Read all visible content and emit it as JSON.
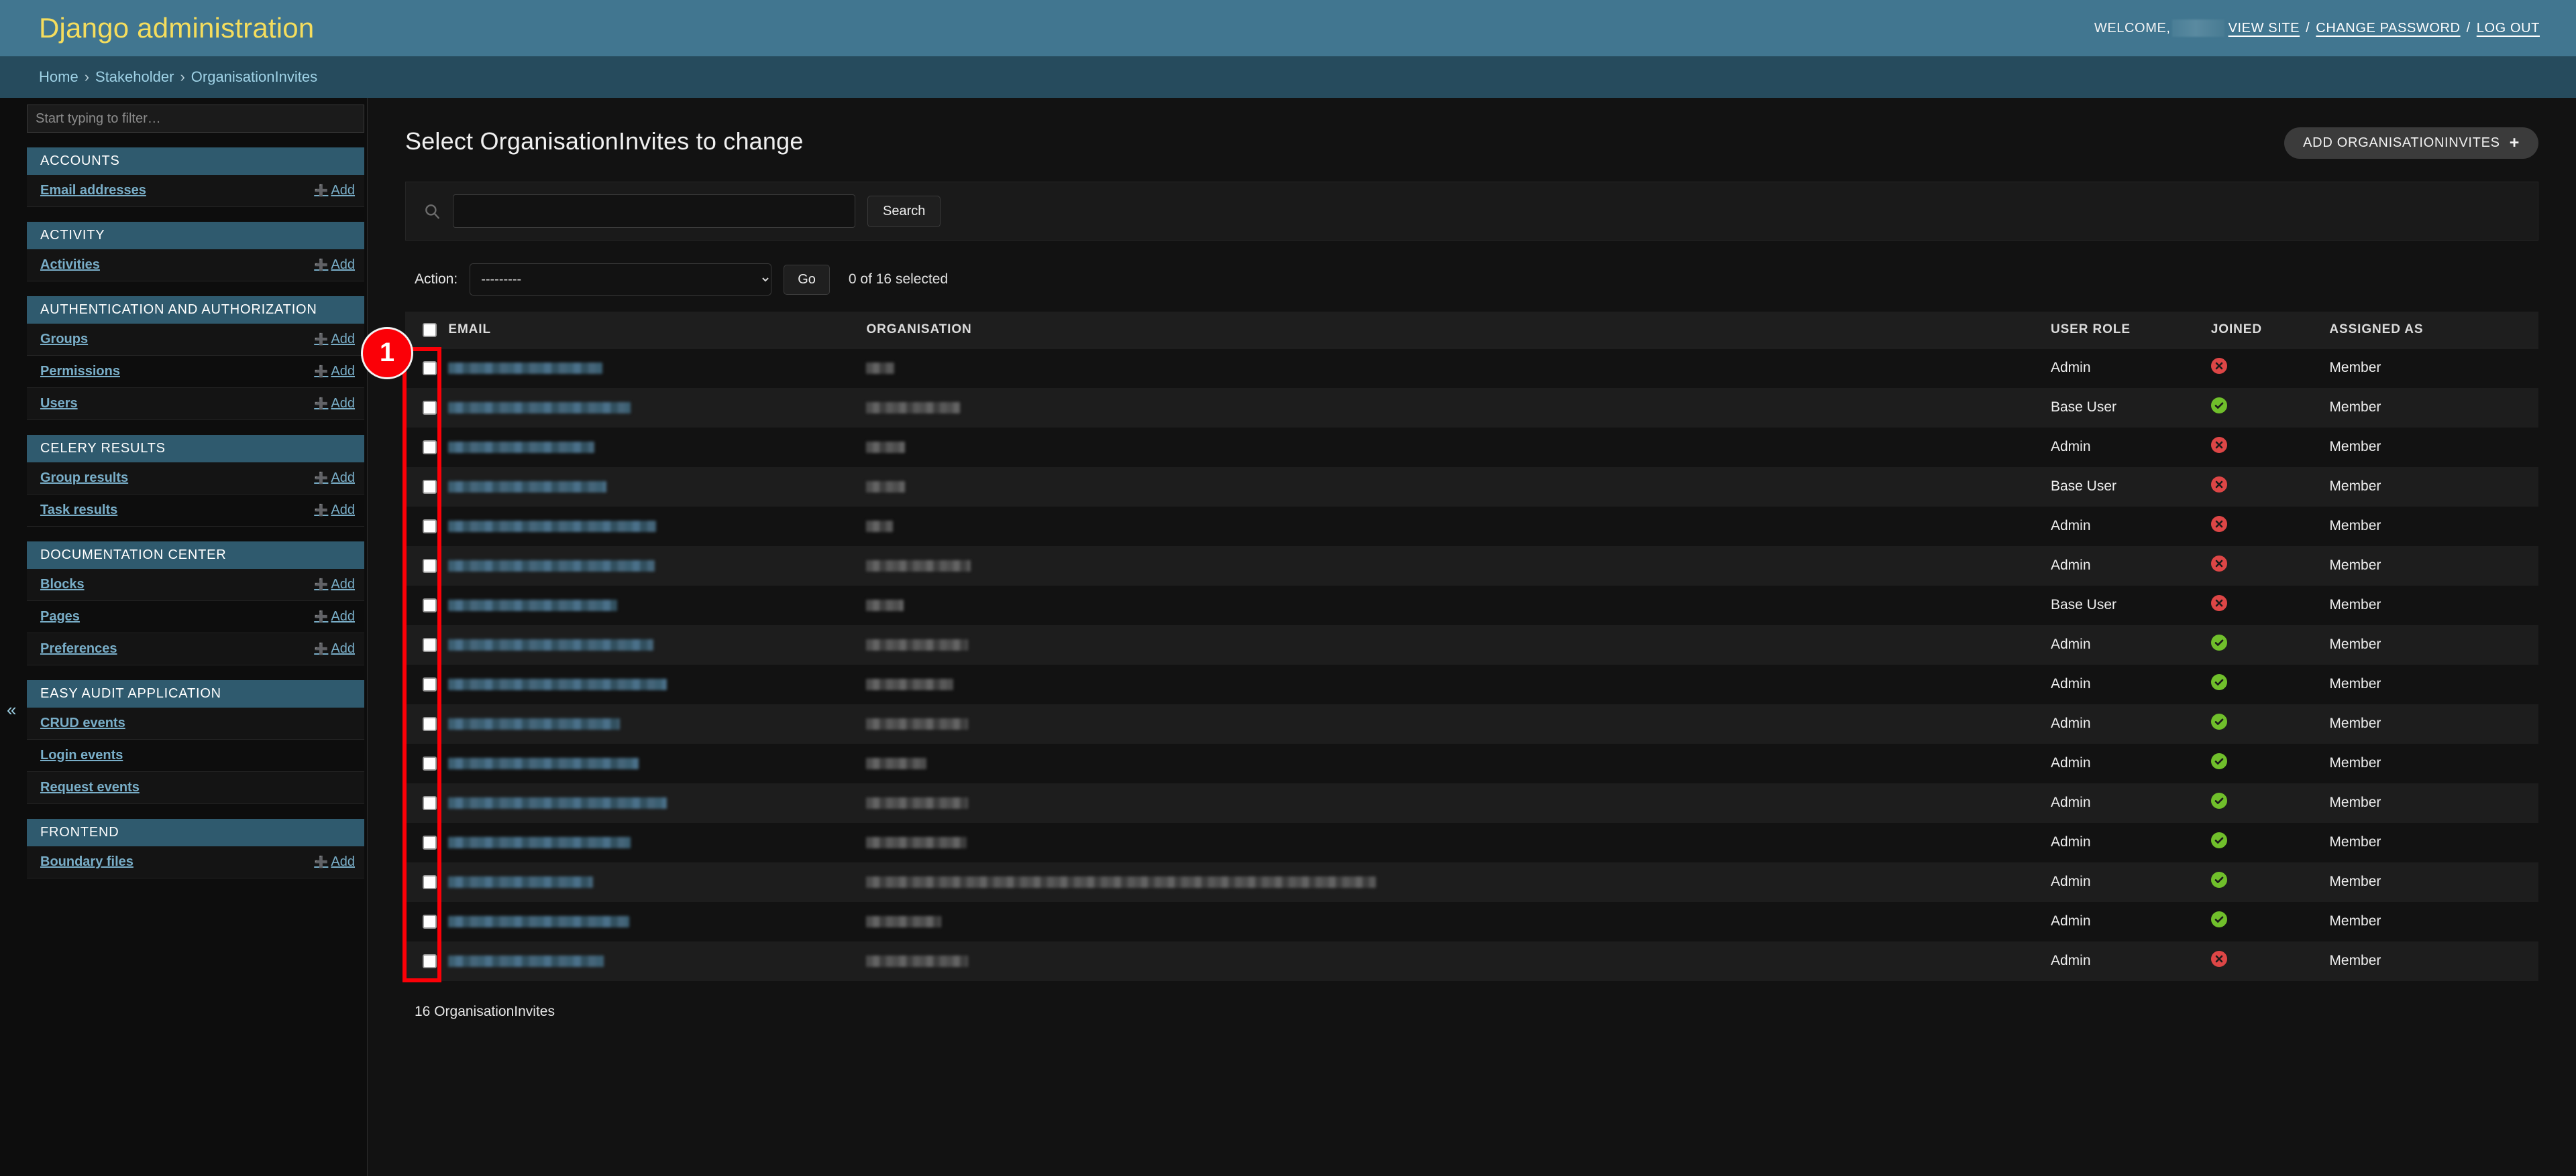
{
  "header": {
    "site_title": "Django administration",
    "welcome_label": "WELCOME,",
    "username_redacted": "",
    "links": [
      {
        "label": "VIEW SITE",
        "name": "view-site-link"
      },
      {
        "label": "CHANGE PASSWORD",
        "name": "change-password-link"
      },
      {
        "label": "LOG OUT",
        "name": "log-out-link"
      }
    ],
    "separator": "/"
  },
  "breadcrumbs": {
    "home": "Home",
    "app": "Stakeholder",
    "current": "OrganisationInvites",
    "separator": "›"
  },
  "sidebar": {
    "filter_placeholder": "Start typing to filter…",
    "filter_value": "",
    "collapse_icon": "«",
    "add_label": "Add",
    "apps": [
      {
        "caption": "ACCOUNTS",
        "models": [
          {
            "label": "Email addresses",
            "add": true
          }
        ]
      },
      {
        "caption": "ACTIVITY",
        "models": [
          {
            "label": "Activities",
            "add": true
          }
        ]
      },
      {
        "caption": "AUTHENTICATION AND AUTHORIZATION",
        "models": [
          {
            "label": "Groups",
            "add": true
          },
          {
            "label": "Permissions",
            "add": true
          },
          {
            "label": "Users",
            "add": true
          }
        ]
      },
      {
        "caption": "CELERY RESULTS",
        "models": [
          {
            "label": "Group results",
            "add": true
          },
          {
            "label": "Task results",
            "add": true
          }
        ]
      },
      {
        "caption": "DOCUMENTATION CENTER",
        "models": [
          {
            "label": "Blocks",
            "add": true
          },
          {
            "label": "Pages",
            "add": true
          },
          {
            "label": "Preferences",
            "add": true
          }
        ]
      },
      {
        "caption": "EASY AUDIT APPLICATION",
        "models": [
          {
            "label": "CRUD events",
            "add": false
          },
          {
            "label": "Login events",
            "add": false
          },
          {
            "label": "Request events",
            "add": false
          }
        ]
      },
      {
        "caption": "FRONTEND",
        "models": [
          {
            "label": "Boundary files",
            "add": true
          }
        ]
      }
    ]
  },
  "content": {
    "page_title": "Select OrganisationInvites to change",
    "add_button_label": "ADD ORGANISATIONINVITES",
    "add_button_icon": "+",
    "search": {
      "value": "",
      "placeholder": "",
      "submit_label": "Search",
      "icon": "search-icon"
    },
    "actions": {
      "label": "Action:",
      "selected_option": "---------",
      "options": [
        "---------"
      ],
      "go_label": "Go",
      "counter": "0 of 16 selected"
    },
    "table": {
      "columns": [
        "EMAIL",
        "ORGANISATION",
        "USER ROLE",
        "JOINED",
        "ASSIGNED AS"
      ],
      "rows": [
        {
          "email_redacted": true,
          "email_width": 230,
          "org_redacted": true,
          "org_width": 42,
          "role": "Admin",
          "joined": false,
          "assigned": "Member"
        },
        {
          "email_redacted": true,
          "email_width": 272,
          "org_redacted": true,
          "org_width": 140,
          "role": "Base User",
          "joined": true,
          "assigned": "Member"
        },
        {
          "email_redacted": true,
          "email_width": 218,
          "org_redacted": true,
          "org_width": 58,
          "role": "Admin",
          "joined": false,
          "assigned": "Member"
        },
        {
          "email_redacted": true,
          "email_width": 236,
          "org_redacted": true,
          "org_width": 58,
          "role": "Base User",
          "joined": false,
          "assigned": "Member"
        },
        {
          "email_redacted": true,
          "email_width": 310,
          "org_redacted": true,
          "org_width": 40,
          "role": "Admin",
          "joined": false,
          "assigned": "Member"
        },
        {
          "email_redacted": true,
          "email_width": 308,
          "org_redacted": true,
          "org_width": 156,
          "role": "Admin",
          "joined": false,
          "assigned": "Member"
        },
        {
          "email_redacted": true,
          "email_width": 252,
          "org_redacted": true,
          "org_width": 56,
          "role": "Base User",
          "joined": false,
          "assigned": "Member"
        },
        {
          "email_redacted": true,
          "email_width": 306,
          "org_redacted": true,
          "org_width": 152,
          "role": "Admin",
          "joined": true,
          "assigned": "Member"
        },
        {
          "email_redacted": true,
          "email_width": 326,
          "org_redacted": true,
          "org_width": 130,
          "role": "Admin",
          "joined": true,
          "assigned": "Member"
        },
        {
          "email_redacted": true,
          "email_width": 256,
          "org_redacted": true,
          "org_width": 152,
          "role": "Admin",
          "joined": true,
          "assigned": "Member"
        },
        {
          "email_redacted": true,
          "email_width": 284,
          "org_redacted": true,
          "org_width": 90,
          "role": "Admin",
          "joined": true,
          "assigned": "Member"
        },
        {
          "email_redacted": true,
          "email_width": 326,
          "org_redacted": true,
          "org_width": 152,
          "role": "Admin",
          "joined": true,
          "assigned": "Member"
        },
        {
          "email_redacted": true,
          "email_width": 272,
          "org_redacted": true,
          "org_width": 150,
          "role": "Admin",
          "joined": true,
          "assigned": "Member"
        },
        {
          "email_redacted": true,
          "email_width": 216,
          "org_redacted": true,
          "org_width": 760,
          "role": "Admin",
          "joined": true,
          "assigned": "Member"
        },
        {
          "email_redacted": true,
          "email_width": 270,
          "org_redacted": true,
          "org_width": 112,
          "role": "Admin",
          "joined": true,
          "assigned": "Member"
        },
        {
          "email_redacted": true,
          "email_width": 232,
          "org_redacted": true,
          "org_width": 152,
          "role": "Admin",
          "joined": false,
          "assigned": "Member"
        }
      ]
    },
    "result_count": "16 OrganisationInvites"
  },
  "annotation": {
    "badge_number": "1",
    "box_color": "#fb0007"
  }
}
